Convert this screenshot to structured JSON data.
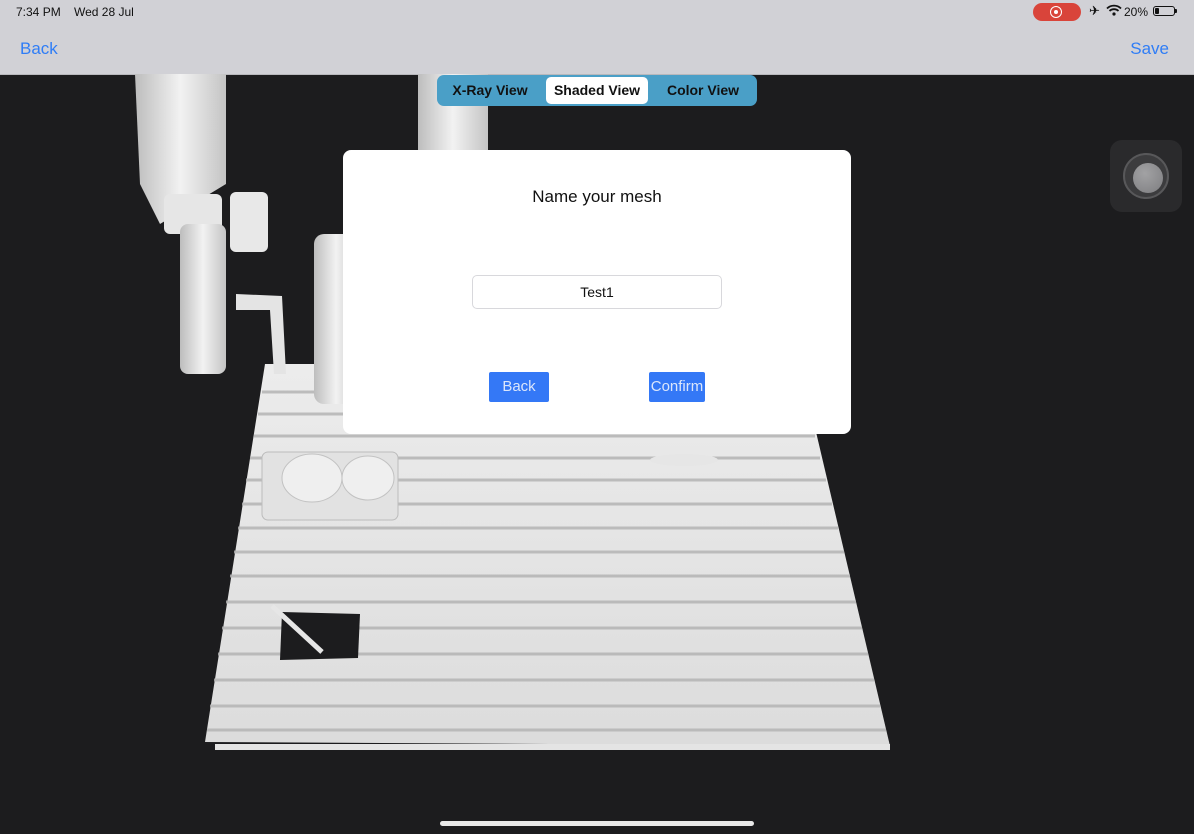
{
  "status_bar": {
    "time": "7:34 PM",
    "date": "Wed 28 Jul",
    "battery_percent": "20%",
    "battery_level": 0.2,
    "icons": [
      "screen-record-icon",
      "airplane-icon",
      "wifi-icon",
      "battery-icon"
    ]
  },
  "nav": {
    "back_label": "Back",
    "save_label": "Save",
    "accent_color": "#2f7df6"
  },
  "view_modes": {
    "options": [
      "X-Ray View",
      "Shaded View",
      "Color View"
    ],
    "selected": "Shaded View",
    "control_color": "#4a9fc7"
  },
  "dialog": {
    "title": "Name your mesh",
    "input_value": "Test1",
    "back_label": "Back",
    "confirm_label": "Confirm",
    "button_color": "#3478f6"
  },
  "capture_button": {
    "icon": "capture-icon"
  }
}
